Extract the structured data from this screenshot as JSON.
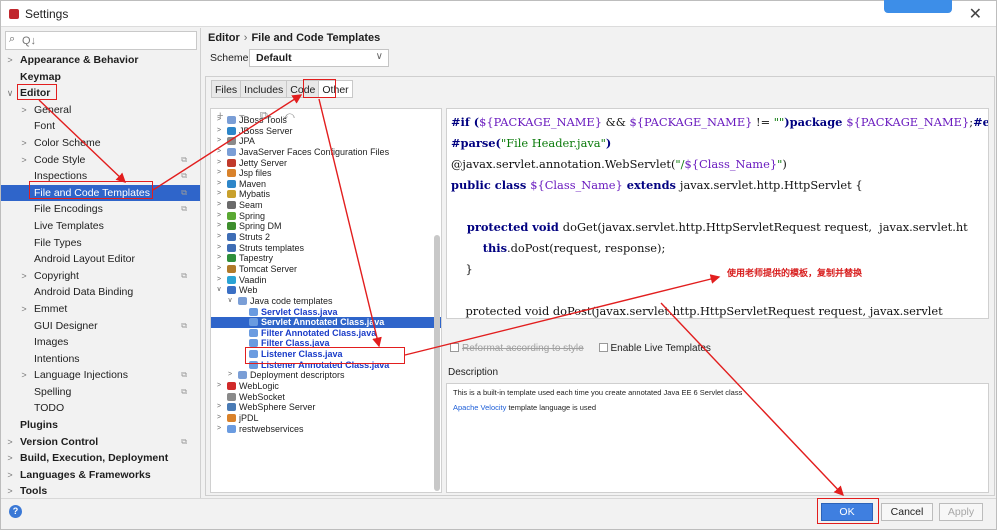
{
  "window": {
    "title": "Settings",
    "badge": ""
  },
  "search": {
    "placeholder": "Q↓"
  },
  "sidebar": {
    "items": [
      {
        "label": "Appearance & Behavior",
        "arrow": ">",
        "bold": true,
        "indent": 0
      },
      {
        "label": "Keymap",
        "arrow": "",
        "bold": true,
        "indent": 0
      },
      {
        "label": "Editor",
        "arrow": "∨",
        "bold": true,
        "indent": 0
      },
      {
        "label": "General",
        "arrow": ">",
        "bold": false,
        "indent": 1
      },
      {
        "label": "Font",
        "arrow": "",
        "bold": false,
        "indent": 1
      },
      {
        "label": "Color Scheme",
        "arrow": ">",
        "bold": false,
        "indent": 1
      },
      {
        "label": "Code Style",
        "arrow": ">",
        "bold": false,
        "indent": 1,
        "proj": true
      },
      {
        "label": "Inspections",
        "arrow": "",
        "bold": false,
        "indent": 1,
        "proj": true
      },
      {
        "label": "File and Code Templates",
        "arrow": "",
        "bold": false,
        "indent": 1,
        "proj": true,
        "selected": true
      },
      {
        "label": "File Encodings",
        "arrow": "",
        "bold": false,
        "indent": 1,
        "proj": true
      },
      {
        "label": "Live Templates",
        "arrow": "",
        "bold": false,
        "indent": 1
      },
      {
        "label": "File Types",
        "arrow": "",
        "bold": false,
        "indent": 1
      },
      {
        "label": "Android Layout Editor",
        "arrow": "",
        "bold": false,
        "indent": 1
      },
      {
        "label": "Copyright",
        "arrow": ">",
        "bold": false,
        "indent": 1,
        "proj": true
      },
      {
        "label": "Android Data Binding",
        "arrow": "",
        "bold": false,
        "indent": 1
      },
      {
        "label": "Emmet",
        "arrow": ">",
        "bold": false,
        "indent": 1
      },
      {
        "label": "GUI Designer",
        "arrow": "",
        "bold": false,
        "indent": 1,
        "proj": true
      },
      {
        "label": "Images",
        "arrow": "",
        "bold": false,
        "indent": 1
      },
      {
        "label": "Intentions",
        "arrow": "",
        "bold": false,
        "indent": 1
      },
      {
        "label": "Language Injections",
        "arrow": ">",
        "bold": false,
        "indent": 1,
        "proj": true
      },
      {
        "label": "Spelling",
        "arrow": "",
        "bold": false,
        "indent": 1,
        "proj": true
      },
      {
        "label": "TODO",
        "arrow": "",
        "bold": false,
        "indent": 1
      },
      {
        "label": "Plugins",
        "arrow": "",
        "bold": true,
        "indent": 0
      },
      {
        "label": "Version Control",
        "arrow": ">",
        "bold": true,
        "indent": 0,
        "proj": true
      },
      {
        "label": "Build, Execution, Deployment",
        "arrow": ">",
        "bold": true,
        "indent": 0
      },
      {
        "label": "Languages & Frameworks",
        "arrow": ">",
        "bold": true,
        "indent": 0
      },
      {
        "label": "Tools",
        "arrow": ">",
        "bold": true,
        "indent": 0
      }
    ]
  },
  "breadcrumb": {
    "parent": "Editor",
    "separator": "›",
    "current": "File and Code Templates"
  },
  "scheme": {
    "label": "Scheme:",
    "value": "Default"
  },
  "tabs": [
    {
      "label": "Files",
      "active": false
    },
    {
      "label": "Includes",
      "active": false
    },
    {
      "label": "Code",
      "active": false
    },
    {
      "label": "Other",
      "active": true
    }
  ],
  "template_tree": {
    "toolbar": "+ − ⧉ ↶",
    "items": [
      {
        "label": "JBoss Tools",
        "arrow": ">",
        "level": 0,
        "icon": "#7a9ed6",
        "type": "folder"
      },
      {
        "label": "JBoss Server",
        "arrow": ">",
        "level": 0,
        "icon": "#2d86c9",
        "type": "folder"
      },
      {
        "label": "JPA",
        "arrow": ">",
        "level": 0,
        "icon": "#8a8a8a",
        "type": "folder"
      },
      {
        "label": "JavaServer Faces Configuration Files",
        "arrow": ">",
        "level": 0,
        "icon": "#7a9ed6",
        "type": "folder"
      },
      {
        "label": "Jetty Server",
        "arrow": ">",
        "level": 0,
        "icon": "#c0392b",
        "type": "folder"
      },
      {
        "label": "Jsp files",
        "arrow": ">",
        "level": 0,
        "icon": "#d9822b",
        "type": "folder"
      },
      {
        "label": "Maven",
        "arrow": ">",
        "level": 0,
        "icon": "#2d86c9",
        "type": "folder"
      },
      {
        "label": "Mybatis",
        "arrow": ">",
        "level": 0,
        "icon": "#c8a02c",
        "type": "folder"
      },
      {
        "label": "Seam",
        "arrow": ">",
        "level": 0,
        "icon": "#6a6a6a",
        "type": "folder"
      },
      {
        "label": "Spring",
        "arrow": ">",
        "level": 0,
        "icon": "#5aa832",
        "type": "folder"
      },
      {
        "label": "Spring DM",
        "arrow": ">",
        "level": 0,
        "icon": "#3e8e2e",
        "type": "folder"
      },
      {
        "label": "Struts 2",
        "arrow": ">",
        "level": 0,
        "icon": "#3e6db5",
        "type": "folder"
      },
      {
        "label": "Struts templates",
        "arrow": ">",
        "level": 0,
        "icon": "#3e6db5",
        "type": "folder"
      },
      {
        "label": "Tapestry",
        "arrow": ">",
        "level": 0,
        "icon": "#2f8f3c",
        "type": "folder"
      },
      {
        "label": "Tomcat Server",
        "arrow": ">",
        "level": 0,
        "icon": "#b07a2a",
        "type": "folder"
      },
      {
        "label": "Vaadin",
        "arrow": ">",
        "level": 0,
        "icon": "#2aa3d4",
        "type": "folder"
      },
      {
        "label": "Web",
        "arrow": "∨",
        "level": 0,
        "icon": "#3a6fc4",
        "type": "folder"
      },
      {
        "label": "Java code templates",
        "arrow": "∨",
        "level": 1,
        "icon": "#7a9ed6",
        "type": "folder"
      },
      {
        "label": "Servlet Class.java",
        "arrow": "",
        "level": 2,
        "icon": "#6a9be0",
        "type": "file"
      },
      {
        "label": "Servlet Annotated Class.java",
        "arrow": "",
        "level": 2,
        "icon": "#6a9be0",
        "type": "file",
        "selected": true
      },
      {
        "label": "Filter Annotated Class.java",
        "arrow": "",
        "level": 2,
        "icon": "#6a9be0",
        "type": "file"
      },
      {
        "label": "Filter Class.java",
        "arrow": "",
        "level": 2,
        "icon": "#6a9be0",
        "type": "file"
      },
      {
        "label": "Listener Class.java",
        "arrow": "",
        "level": 2,
        "icon": "#6a9be0",
        "type": "file"
      },
      {
        "label": "Listener Annotated Class.java",
        "arrow": "",
        "level": 2,
        "icon": "#6a9be0",
        "type": "file"
      },
      {
        "label": "Deployment descriptors",
        "arrow": ">",
        "level": 1,
        "icon": "#7a9ed6",
        "type": "folder"
      },
      {
        "label": "WebLogic",
        "arrow": ">",
        "level": 0,
        "icon": "#d02a2a",
        "type": "folder"
      },
      {
        "label": "WebSocket",
        "arrow": "",
        "level": 0,
        "icon": "#8a8a8a",
        "type": "folder"
      },
      {
        "label": "WebSphere Server",
        "arrow": ">",
        "level": 0,
        "icon": "#4a7bb5",
        "type": "folder"
      },
      {
        "label": "jPDL",
        "arrow": ">",
        "level": 0,
        "icon": "#d9822b",
        "type": "folder"
      },
      {
        "label": "restwebservices",
        "arrow": ">",
        "level": 0,
        "icon": "#6a9be0",
        "type": "folder"
      }
    ]
  },
  "editor": {
    "lines": [
      [
        {
          "t": "#if (",
          "c": "kw"
        },
        {
          "t": "${PACKAGE_NAME}",
          "c": "vr"
        },
        {
          "t": " && ",
          "c": ""
        },
        {
          "t": "${PACKAGE_NAME}",
          "c": "vr"
        },
        {
          "t": " != ",
          "c": ""
        },
        {
          "t": "\"\"",
          "c": "str"
        },
        {
          "t": ")package ",
          "c": "kw"
        },
        {
          "t": "${PACKAGE_NAME}",
          "c": "vr"
        },
        {
          "t": ";",
          "c": ""
        },
        {
          "t": "#end",
          "c": "kw"
        }
      ],
      [
        {
          "t": "#parse(",
          "c": "kw"
        },
        {
          "t": "\"File Header.java\"",
          "c": "str"
        },
        {
          "t": ")",
          "c": "kw"
        }
      ],
      [
        {
          "t": "@javax.servlet.annotation.WebServlet(",
          "c": ""
        },
        {
          "t": "\"/",
          "c": "str"
        },
        {
          "t": "${Class_Name}",
          "c": "vr"
        },
        {
          "t": "\"",
          "c": "str"
        },
        {
          "t": ")",
          "c": ""
        }
      ],
      [
        {
          "t": "public class ",
          "c": "kw"
        },
        {
          "t": "${Class_Name}",
          "c": "vr"
        },
        {
          "t": " extends ",
          "c": "kw"
        },
        {
          "t": "javax.servlet.http.HttpServlet {",
          "c": ""
        }
      ],
      [],
      [
        {
          "t": "    protected void ",
          "c": "kw"
        },
        {
          "t": "doGet(javax.servlet.http.HttpServletRequest request,  javax.servlet.ht",
          "c": ""
        }
      ],
      [
        {
          "t": "        this",
          "c": "kw"
        },
        {
          "t": ".doPost(request, response);",
          "c": ""
        }
      ],
      [
        {
          "t": "    }",
          "c": ""
        }
      ],
      [],
      [
        {
          "t": "    protected void doPost(javax.servlet.http.HttpServletRequest request, javax.servlet",
          "c": ""
        }
      ]
    ]
  },
  "annotation": {
    "note": "使用老师提供的模板，复制并替换"
  },
  "options": {
    "reformat": "Reformat according to style",
    "live": "Enable Live Templates"
  },
  "description": {
    "label": "Description",
    "line1": "This is a built-in template used each time you create annotated Java EE 6 Servlet class",
    "link": "Apache Velocity",
    "line2_rest": " template language is used"
  },
  "buttons": {
    "ok": "OK",
    "cancel": "Cancel",
    "apply": "Apply",
    "help": "?"
  },
  "colors": {
    "selection": "#2f65ca",
    "annotation_red": "#e21e1e",
    "ok_blue": "#3f7fe0"
  }
}
